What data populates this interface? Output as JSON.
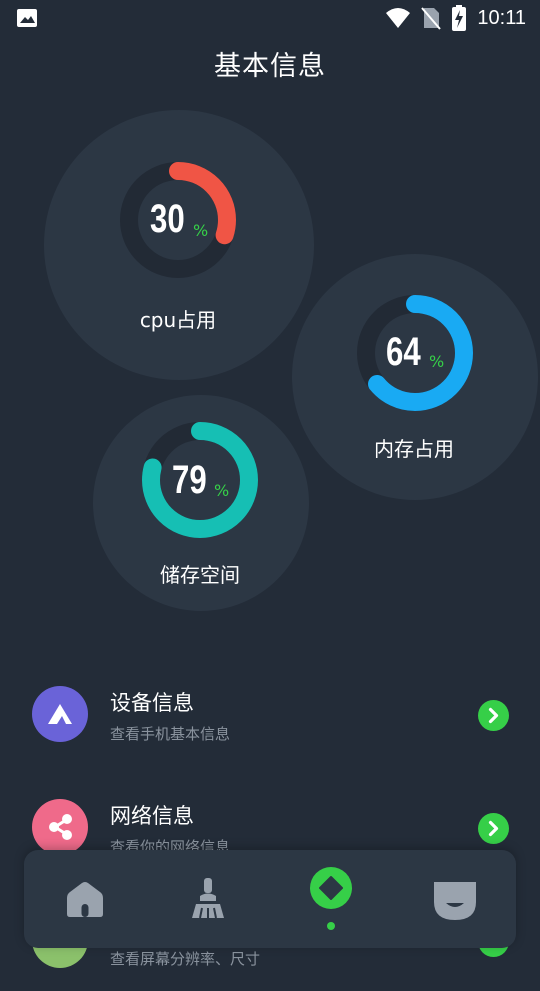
{
  "statusbar": {
    "time": "10:11"
  },
  "page": {
    "title": "基本信息"
  },
  "gauges": {
    "cpu": {
      "value": "30",
      "unit": "%",
      "label": "cpu占用",
      "fraction": 0.3,
      "color": "#f05545"
    },
    "memory": {
      "value": "64",
      "unit": "%",
      "label": "内存占用",
      "fraction": 0.64,
      "color": "#19aaf3"
    },
    "storage": {
      "value": "79",
      "unit": "%",
      "label": "储存空间",
      "fraction": 0.79,
      "color": "#16bfb4"
    }
  },
  "list": [
    {
      "title": "设备信息",
      "subtitle": "查看手机基本信息",
      "icon": "triangle-logo-icon",
      "color": "#6a63d8"
    },
    {
      "title": "网络信息",
      "subtitle": "查看你的网络信息",
      "icon": "share-nodes-icon",
      "color": "#ef6a8a"
    },
    {
      "title": "",
      "subtitle": "查看屏幕分辨率、尺寸",
      "icon": "screen-icon",
      "color": "#8bc16b"
    }
  ],
  "nav": {
    "items": [
      {
        "icon": "home-icon"
      },
      {
        "icon": "broom-icon"
      },
      {
        "icon": "diamond-icon",
        "active": true
      },
      {
        "icon": "smile-badge-icon"
      }
    ],
    "active_color": "#36cf48",
    "inactive_color": "#9aa3ae"
  }
}
